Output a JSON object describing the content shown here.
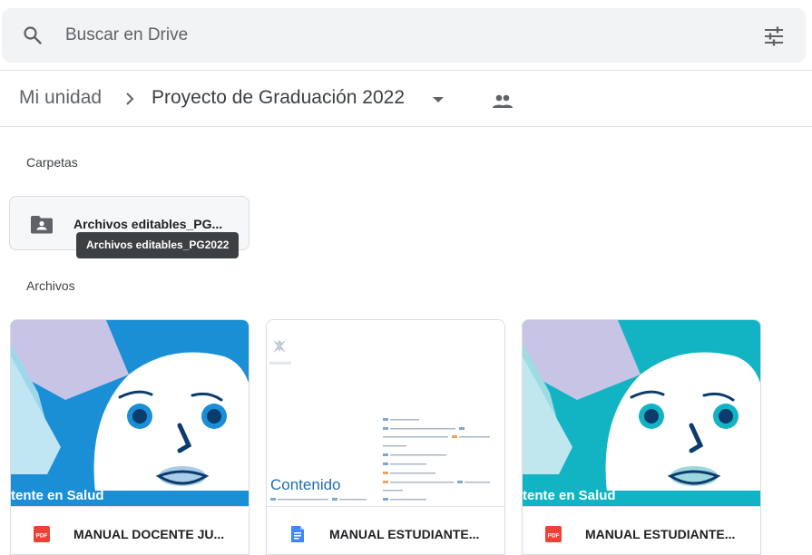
{
  "search": {
    "placeholder": "Buscar en Drive",
    "value": ""
  },
  "breadcrumb": {
    "root": "Mi unidad",
    "current": "Proyecto de Graduación 2022"
  },
  "sections": {
    "folders_title": "Carpetas",
    "files_title": "Archivos"
  },
  "folder": {
    "name": "Archivos editables_PG...",
    "tooltip": "Archivos editables_PG2022"
  },
  "files": [
    {
      "name": "MANUAL DOCENTE JU...",
      "type": "pdf",
      "thumb_caption": "tente en Salud",
      "thumb_color": "#1b8fd6"
    },
    {
      "name": "MANUAL ESTUDIANTE...",
      "type": "doc",
      "thumb_title": "Contenido"
    },
    {
      "name": "MANUAL ESTUDIANTE...",
      "type": "pdf",
      "thumb_caption": "tente en Salud",
      "thumb_color": "#12b4c4"
    }
  ],
  "colors": {
    "pdf": "#ea4335",
    "doc": "#4285f4",
    "skin": "#ffffff",
    "accent_lilac": "#c8c4e6"
  }
}
